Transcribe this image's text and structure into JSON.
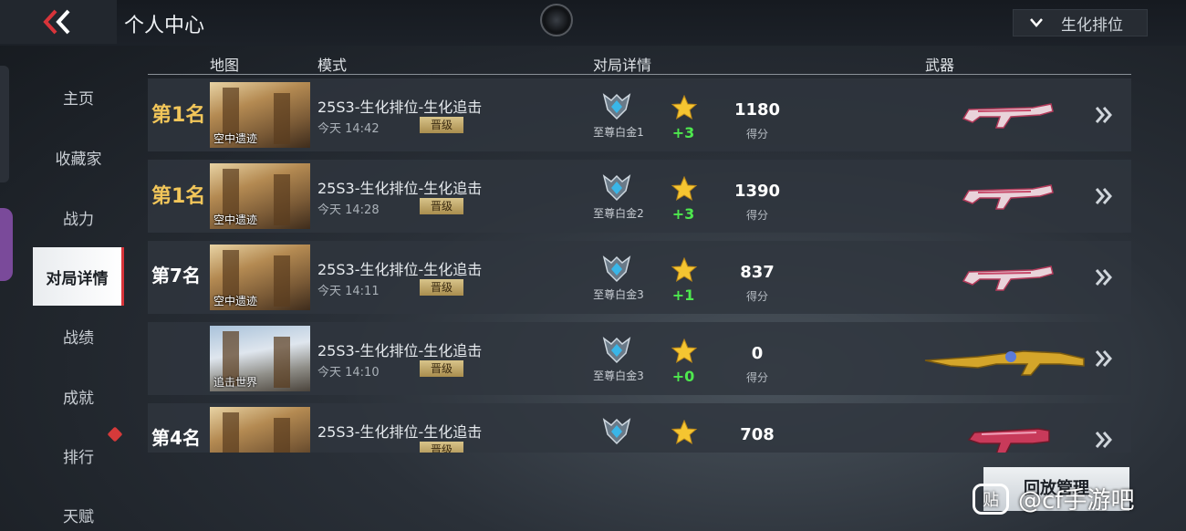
{
  "header": {
    "title": "个人中心",
    "mode_select": "生化排位"
  },
  "sidebar": {
    "items": [
      {
        "label": "主页"
      },
      {
        "label": "收藏家"
      },
      {
        "label": "战力"
      },
      {
        "label": "对局详情"
      },
      {
        "label": "战绩"
      },
      {
        "label": "成就"
      },
      {
        "label": "排行"
      },
      {
        "label": "天赋"
      }
    ],
    "active": "对局详情"
  },
  "table": {
    "headers": {
      "map": "地图",
      "mode": "模式",
      "details": "对局详情",
      "weapon": "武器"
    },
    "rows": [
      {
        "rank": "第1名",
        "map": "空中遗迹",
        "mode": "25S3-生化排位-生化追击",
        "time": "今天 14:42",
        "tag": "晋级",
        "tier": "至尊白金1",
        "stars": "+3",
        "score": "1180",
        "score_label": "得分",
        "weapon": "pink-rifle"
      },
      {
        "rank": "第1名",
        "map": "空中遗迹",
        "mode": "25S3-生化排位-生化追击",
        "time": "今天 14:28",
        "tag": "晋级",
        "tier": "至尊白金2",
        "stars": "+3",
        "score": "1390",
        "score_label": "得分",
        "weapon": "pink-rifle"
      },
      {
        "rank": "第7名",
        "map": "空中遗迹",
        "mode": "25S3-生化排位-生化追击",
        "time": "今天 14:11",
        "tag": "晋级",
        "tier": "至尊白金3",
        "stars": "+1",
        "score": "837",
        "score_label": "得分",
        "weapon": "pink-rifle"
      },
      {
        "rank": "",
        "map": "追击世界",
        "mode": "25S3-生化排位-生化追击",
        "time": "今天 14:10",
        "tag": "晋级",
        "tier": "至尊白金3",
        "stars": "+0",
        "score": "0",
        "score_label": "得分",
        "weapon": "gold-ak"
      },
      {
        "rank": "第4名",
        "map": "",
        "mode": "25S3-生化排位-生化追击",
        "time": "",
        "tag": "晋级",
        "tier": "",
        "stars": "",
        "score": "708",
        "score_label": "得分",
        "weapon": "red-rifle"
      }
    ]
  },
  "footer": {
    "replay_button": "回放管理",
    "watermark": "@cf手游吧",
    "watermark_logo": "贴"
  },
  "colors": {
    "gold_rank": "#f2c65a",
    "star_delta": "#4ee84e",
    "active_marker": "#d8343a"
  }
}
